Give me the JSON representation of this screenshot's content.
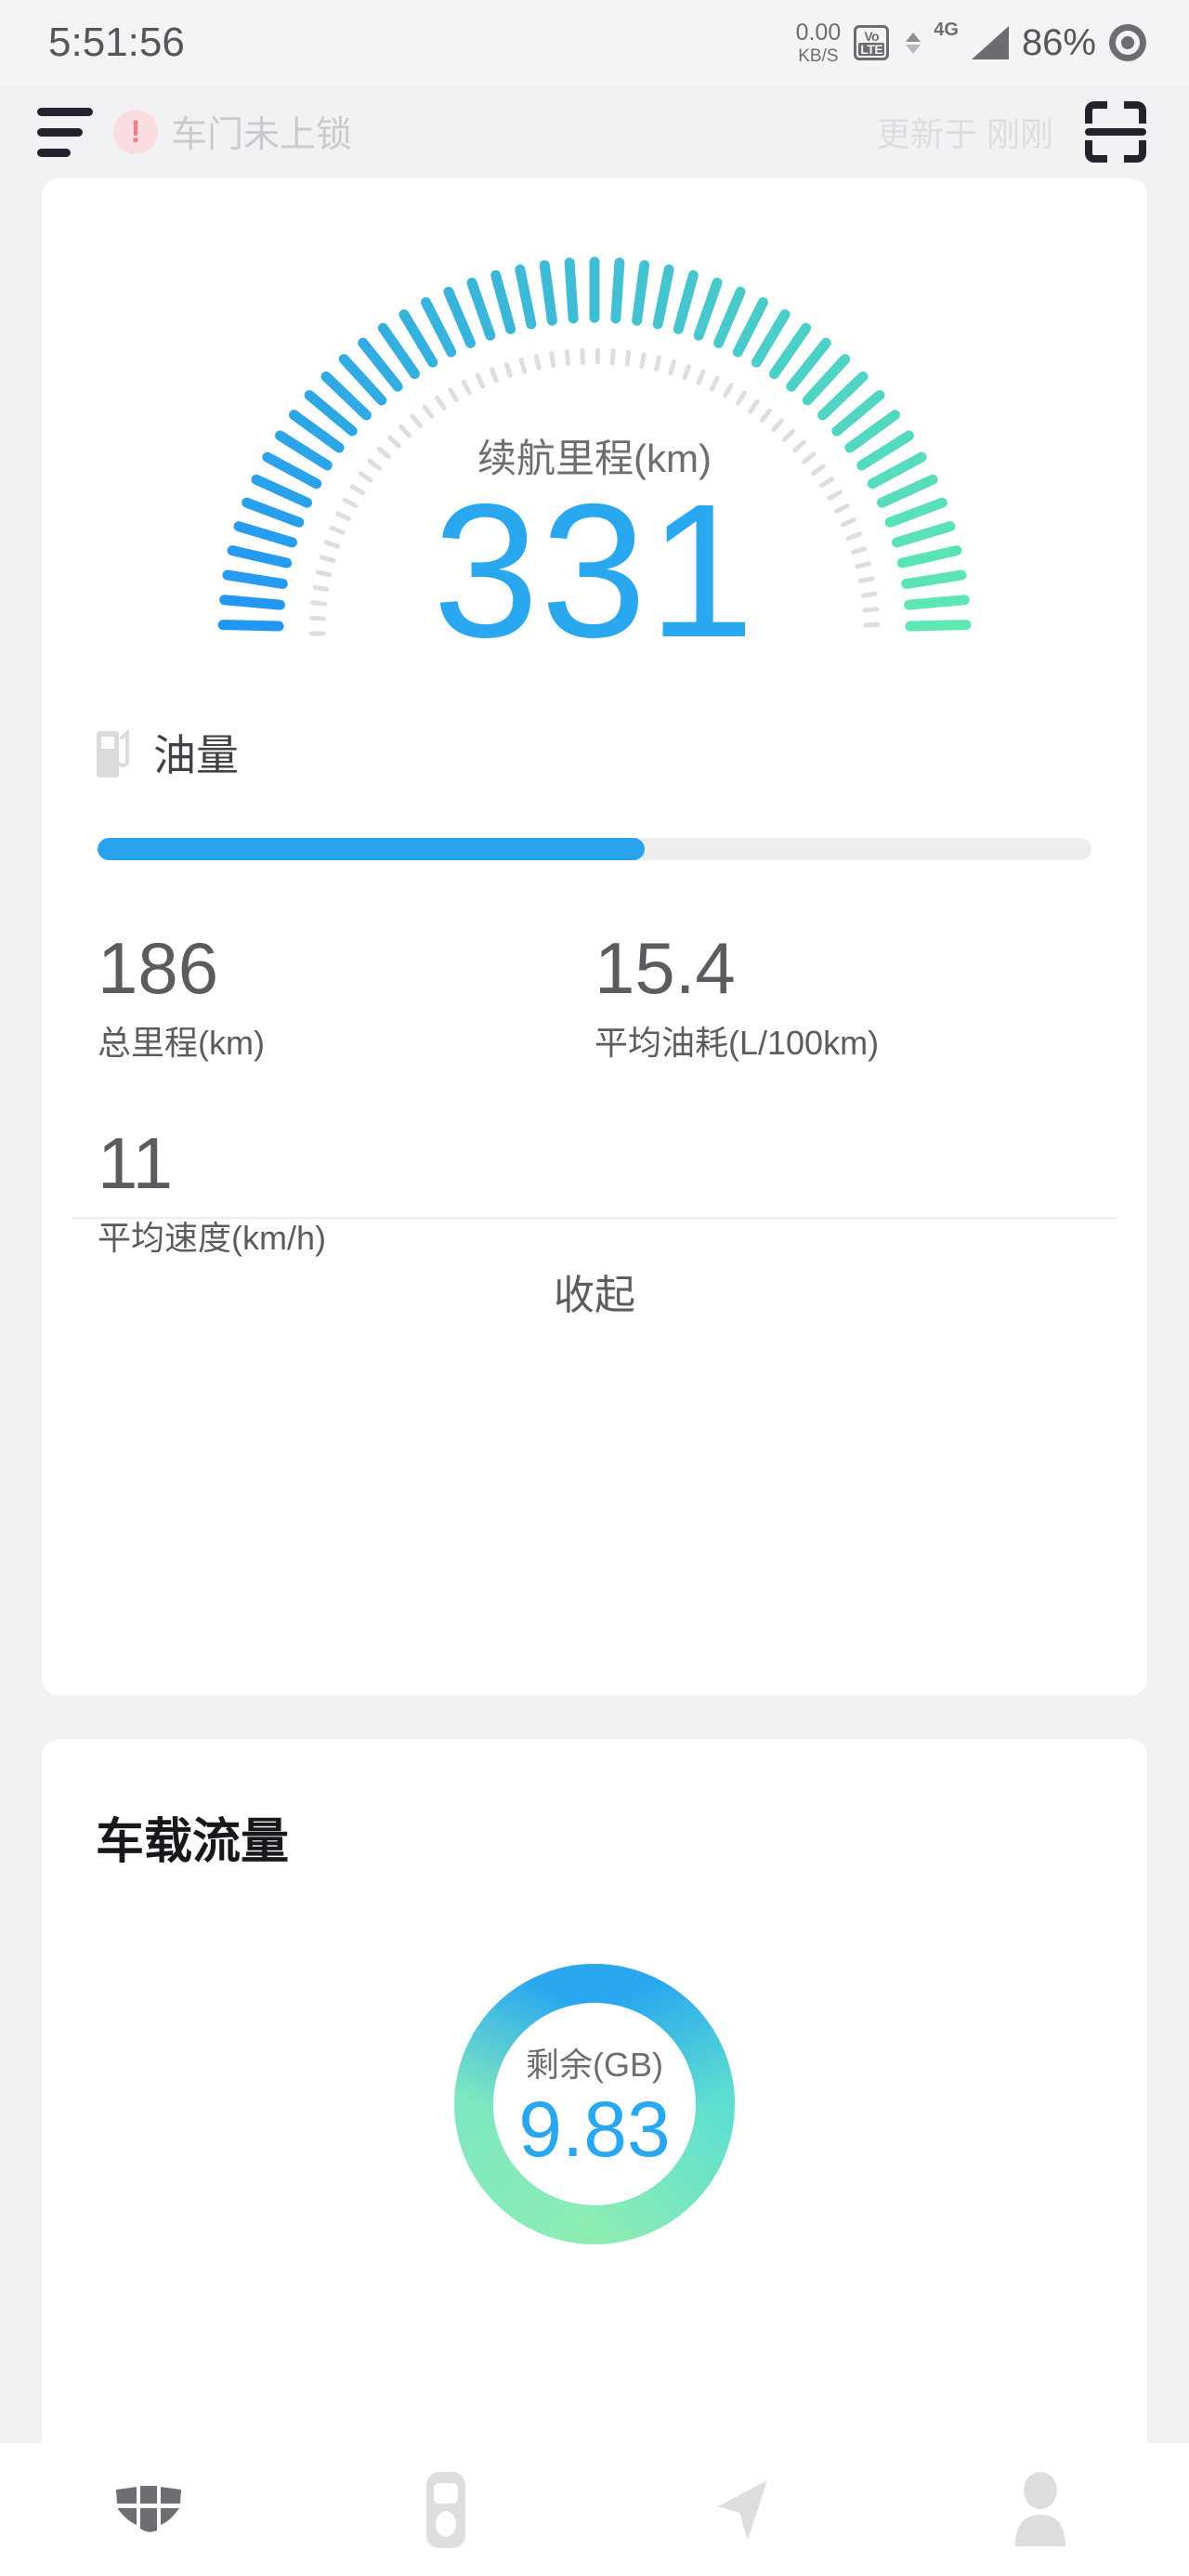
{
  "statusbar": {
    "clock": "5:51:56",
    "net_rate": "0.00",
    "net_unit": "KB/S",
    "volte_top": "Vo",
    "volte_bottom": "LTE",
    "network_gen": "4G",
    "battery": "86%"
  },
  "header": {
    "menu_icon": "hamburger-icon",
    "warning_badge": "!",
    "warning_text": "车门未上锁",
    "updated_text": "更新于 刚刚",
    "scan_icon": "qr-scan-icon"
  },
  "status_card": {
    "gauge": {
      "label": "续航里程(km)",
      "value": "331"
    },
    "fuel": {
      "icon": "fuel-pump-icon",
      "label": "油量",
      "percent": 55
    },
    "stats": [
      {
        "value": "186",
        "label": "总里程(km)"
      },
      {
        "value": "15.4",
        "label": "平均油耗(L/100km)"
      },
      {
        "value": "11",
        "label": "平均速度(km/h)"
      }
    ],
    "collapse_label": "收起"
  },
  "data_card": {
    "title": "车载流量",
    "donut": {
      "label": "剩余(GB)",
      "value": "9.83",
      "percent": 100
    }
  },
  "bottomnav": [
    {
      "icon": "car-grille-icon",
      "active": true
    },
    {
      "icon": "remote-key-icon",
      "active": false
    },
    {
      "icon": "navigation-arrow-icon",
      "active": false
    },
    {
      "icon": "person-icon",
      "active": false
    }
  ],
  "colors": {
    "accent_blue": "#2aa8ef",
    "gauge_start": "#2196f3",
    "gauge_end": "#5fe8b4",
    "page_bg": "#f2f2f4",
    "card_bg": "#ffffff",
    "warning_pink": "#f9dde0"
  },
  "chart_data": [
    {
      "type": "gauge",
      "title": "续航里程(km)",
      "value": 331,
      "unit": "km",
      "ticks": 47,
      "gradient": [
        "#2196f3",
        "#5fe8b4"
      ]
    },
    {
      "type": "bar",
      "title": "油量",
      "categories": [
        "油量"
      ],
      "values": [
        55
      ],
      "ylim": [
        0,
        100
      ],
      "ylabel": "%",
      "color": "#2aa3ef"
    },
    {
      "type": "pie",
      "title": "车载流量",
      "categories": [
        "剩余(GB)"
      ],
      "values": [
        9.83
      ],
      "annotations": [
        "剩余(GB)",
        "9.83"
      ],
      "gradient": [
        "#2aa8ef",
        "#7fe8b8"
      ]
    }
  ]
}
